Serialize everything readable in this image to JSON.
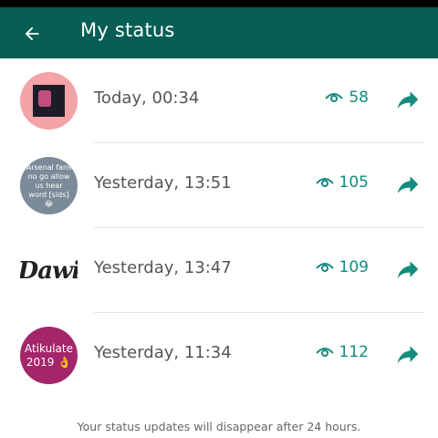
{
  "header": {
    "title": "My status"
  },
  "statuses": [
    {
      "time": "Today, 00:34",
      "views": "58"
    },
    {
      "time": "Yesterday, 13:51",
      "views": "105",
      "avatar_text": "Arsenal fans no go allow us hear word [sids] 😂"
    },
    {
      "time": "Yesterday, 13:47",
      "views": "109",
      "avatar_text": "Dawi"
    },
    {
      "time": "Yesterday, 11:34",
      "views": "112",
      "avatar_text": "Atikulate 2019 👌"
    }
  ],
  "footer": {
    "note": "Your status updates will disappear after 24 hours."
  },
  "colors": {
    "header_bg": "#075e54",
    "accent": "#128c7e"
  },
  "icons": {
    "back": "arrow-left-icon",
    "views": "eye-icon",
    "forward": "share-forward-icon"
  }
}
